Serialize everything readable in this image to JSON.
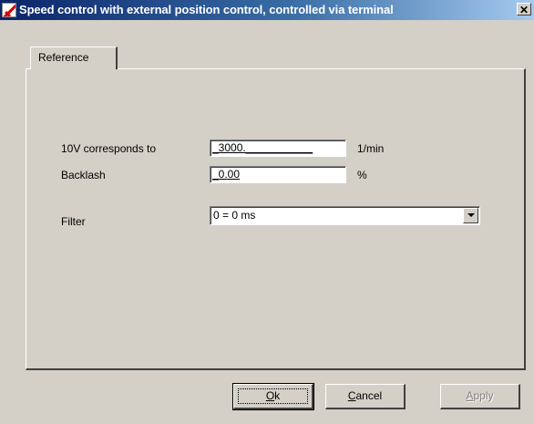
{
  "window": {
    "title": "Speed control with external position control, controlled via terminal",
    "close_glyph": "✕"
  },
  "tabs": [
    {
      "label": "Reference"
    }
  ],
  "form": {
    "reference_voltage": {
      "label": "10V corresponds to",
      "value": "_3000.___________",
      "unit": "1/min"
    },
    "backlash": {
      "label": "Backlash",
      "value": "_0.00",
      "unit": "%"
    },
    "filter": {
      "label": "Filter",
      "value": "0 = 0 ms"
    }
  },
  "buttons": {
    "ok": {
      "mnemonic": "O",
      "rest": "k"
    },
    "cancel": {
      "mnemonic": "C",
      "rest": "ancel"
    },
    "apply": {
      "mnemonic": "A",
      "rest": "pply"
    }
  },
  "colors": {
    "titlebar_start": "#0a246a",
    "titlebar_end": "#a6caf0",
    "face": "#d4d0c8"
  },
  "icons": {
    "app": "app-icon",
    "close": "close-icon",
    "dropdown": "chevron-down-icon"
  }
}
